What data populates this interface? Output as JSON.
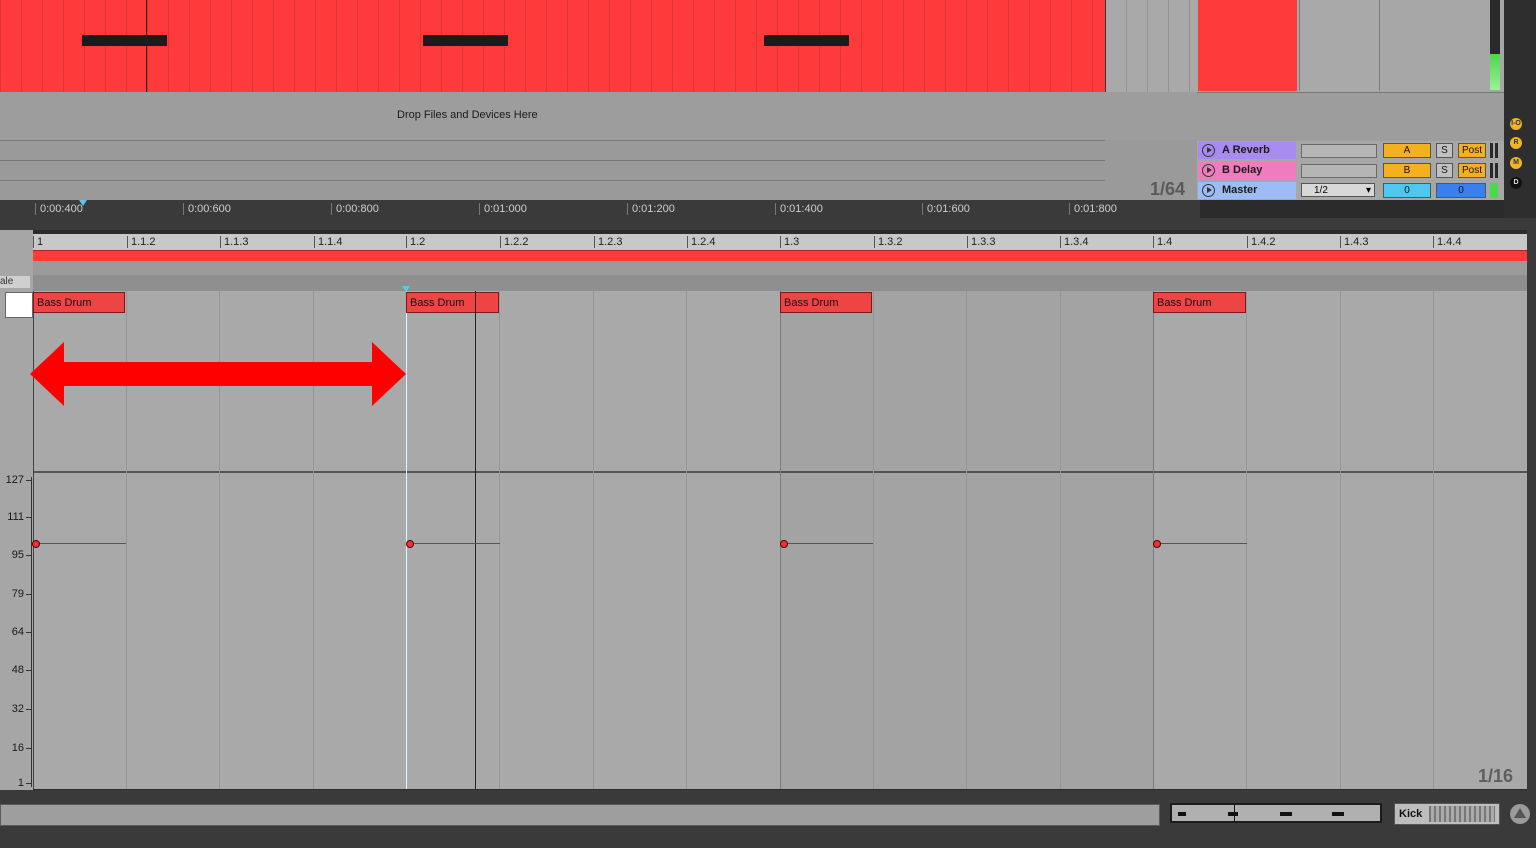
{
  "arrangement": {
    "drop_label": "Drop Files and Devices Here",
    "grid_quantize": "1/64",
    "time_ticks": [
      "0:00:400",
      "0:00:600",
      "0:00:800",
      "0:01:000",
      "0:01:200",
      "0:01:400",
      "0:01:600",
      "0:01:800"
    ]
  },
  "mixer": {
    "returns": [
      {
        "name": "A Reverb",
        "letter": "A",
        "solo": "S",
        "post": "Post",
        "color": "#a88bf0"
      },
      {
        "name": "B Delay",
        "letter": "B",
        "solo": "S",
        "post": "Post",
        "color": "#f07cc0"
      },
      {
        "name": "Master",
        "crossfade": "1/2",
        "value_a": "0",
        "value_b": "0",
        "color": "#9bbcf5"
      }
    ],
    "side_buttons": [
      "I-O",
      "R",
      "M",
      "D"
    ]
  },
  "editor": {
    "left_label": "ale",
    "bar_ruler": [
      "1",
      "1.1.2",
      "1.1.3",
      "1.1.4",
      "1.2",
      "1.2.2",
      "1.2.3",
      "1.2.4",
      "1.3",
      "1.3.2",
      "1.3.3",
      "1.3.4",
      "1.4",
      "1.4.2",
      "1.4.3",
      "1.4.4"
    ],
    "notes": [
      {
        "label": "Bass Drum",
        "start": "1",
        "length": "1/16"
      },
      {
        "label": "Bass Drum",
        "start": "1.2",
        "length": "1/16"
      },
      {
        "label": "Bass Drum",
        "start": "1.3",
        "length": "1/16"
      },
      {
        "label": "Bass Drum",
        "start": "1.4",
        "length": "1/16"
      }
    ],
    "velocity_scale": [
      "127",
      "111",
      "95",
      "79",
      "64",
      "48",
      "32",
      "16",
      "1"
    ],
    "note_velocity": 100,
    "grid_quantize": "1/16"
  },
  "footer": {
    "clip_name": "Kick"
  },
  "colors": {
    "clip_red": "#ff3a3a",
    "annotation_arrow": "#ff0000"
  }
}
